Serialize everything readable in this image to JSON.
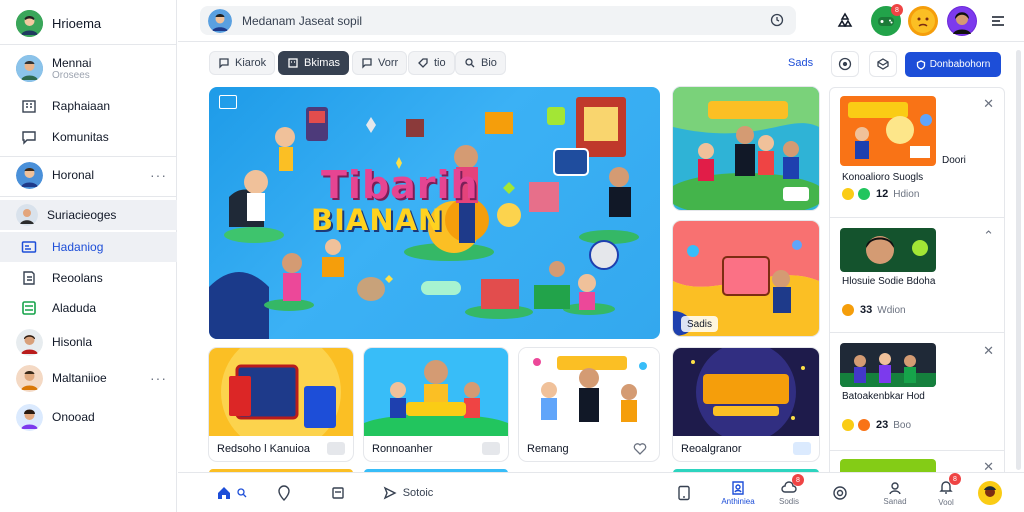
{
  "colors": {
    "accent": "#1d4ed8",
    "hero_bg": "#2aa6ee",
    "badge": "#ef4444",
    "active_row": "#eef0f4"
  },
  "sidebar": {
    "profile": {
      "name": "Hrioema",
      "avatar": "avatar-green"
    },
    "items": [
      {
        "label": "Mennai",
        "sub": "Orosees",
        "kind": "avatar"
      },
      {
        "label": "Raphaiaan",
        "kind": "icon",
        "icon": "building-icon"
      },
      {
        "label": "Komunitas",
        "kind": "icon",
        "icon": "chat-icon"
      },
      {
        "label": "Horonal",
        "kind": "avatar",
        "more": "···"
      },
      {
        "label": "Suriacieoges",
        "kind": "avatar"
      },
      {
        "label": "Hadaniog",
        "kind": "icon",
        "icon": "id-card-icon"
      },
      {
        "label": "Reoolans",
        "kind": "icon",
        "icon": "book-icon"
      },
      {
        "label": "Aladuda",
        "kind": "icon",
        "icon": "list-green-icon"
      },
      {
        "label": "Hisonla",
        "kind": "avatar"
      },
      {
        "label": "Maltaniioe",
        "kind": "avatar",
        "more": "···"
      },
      {
        "label": "Onooad",
        "kind": "avatar"
      }
    ]
  },
  "topbar": {
    "search_value": "Medanam Jaseat sopil",
    "notification_count": "8"
  },
  "filters": [
    {
      "label": "Kiarok"
    },
    {
      "label": "Bkimas"
    },
    {
      "label": "Vorr"
    },
    {
      "label": "tio"
    },
    {
      "label": "Bio"
    }
  ],
  "actions": {
    "link": "Sads",
    "primary": "Donbabohorn"
  },
  "hero": {
    "title_line1": "Tibarih",
    "title_line2": "BIANAN"
  },
  "cards_right": [
    {
      "label": ""
    },
    {
      "label": "Sadis"
    }
  ],
  "cards_bottom": [
    {
      "label": "Redsoho l Kanuioa"
    },
    {
      "label": "Ronnoanher"
    },
    {
      "label": "Remang"
    },
    {
      "label": "Reoalgranor"
    }
  ],
  "right_list": [
    {
      "title": "Konoalioro Suogls",
      "caption": "Doori",
      "count": "12",
      "meta": "Hdion"
    },
    {
      "title": "Hlosuie Sodie Bdoha",
      "count": "33",
      "meta": "Wdion"
    },
    {
      "title": "Batoakenbkar Hod",
      "count": "23",
      "meta": "Boo"
    },
    {
      "title": "",
      "count": "",
      "meta": ""
    }
  ],
  "bottombar": {
    "items": [
      {
        "label": "",
        "icon": "home-icon"
      },
      {
        "label": "",
        "icon": "pin-icon"
      },
      {
        "label": "",
        "icon": "note-icon"
      },
      {
        "label": "Sotoic",
        "icon": "send-icon"
      },
      {
        "label": "",
        "icon": "tablet-icon"
      },
      {
        "label": "Anthiniea",
        "icon": "profile-card-icon"
      },
      {
        "label": "Sodis",
        "icon": "cloud-icon",
        "badge": "8"
      },
      {
        "label": "",
        "icon": "target-icon"
      },
      {
        "label": "Sanad",
        "icon": "person-icon"
      },
      {
        "label": "Vool",
        "icon": "bell-icon",
        "badge": "8"
      }
    ]
  },
  "hero_heading_title": "Tibarih",
  "hero_heading_sub": "BIANAN"
}
